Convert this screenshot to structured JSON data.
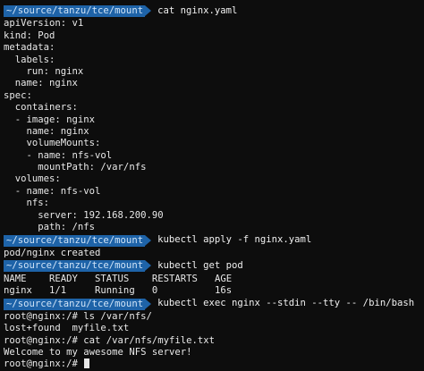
{
  "prompt": {
    "path": "~/source/tanzu/tce/mount"
  },
  "commands": {
    "cat": "cat nginx.yaml",
    "apply": "kubectl apply -f nginx.yaml",
    "get": "kubectl get pod",
    "exec": "kubectl exec nginx --stdin --tty -- /bin/bash"
  },
  "yaml_lines": [
    "apiVersion: v1",
    "kind: Pod",
    "metadata:",
    "  labels:",
    "    run: nginx",
    "  name: nginx",
    "spec:",
    "  containers:",
    "  - image: nginx",
    "    name: nginx",
    "    volumeMounts:",
    "    - name: nfs-vol",
    "      mountPath: /var/nfs",
    "  volumes:",
    "  - name: nfs-vol",
    "    nfs:",
    "      server: 192.168.200.90",
    "      path: /nfs"
  ],
  "apply_output": "pod/nginx created",
  "pod_table": {
    "header": "NAME    READY   STATUS    RESTARTS   AGE",
    "row": "nginx   1/1     Running   0          16s"
  },
  "shell_lines": [
    "root@nginx:/# ls /var/nfs/",
    "lost+found  myfile.txt",
    "root@nginx:/# cat /var/nfs/myfile.txt",
    "Welcome to my awesome NFS server!",
    "root@nginx:/# "
  ]
}
